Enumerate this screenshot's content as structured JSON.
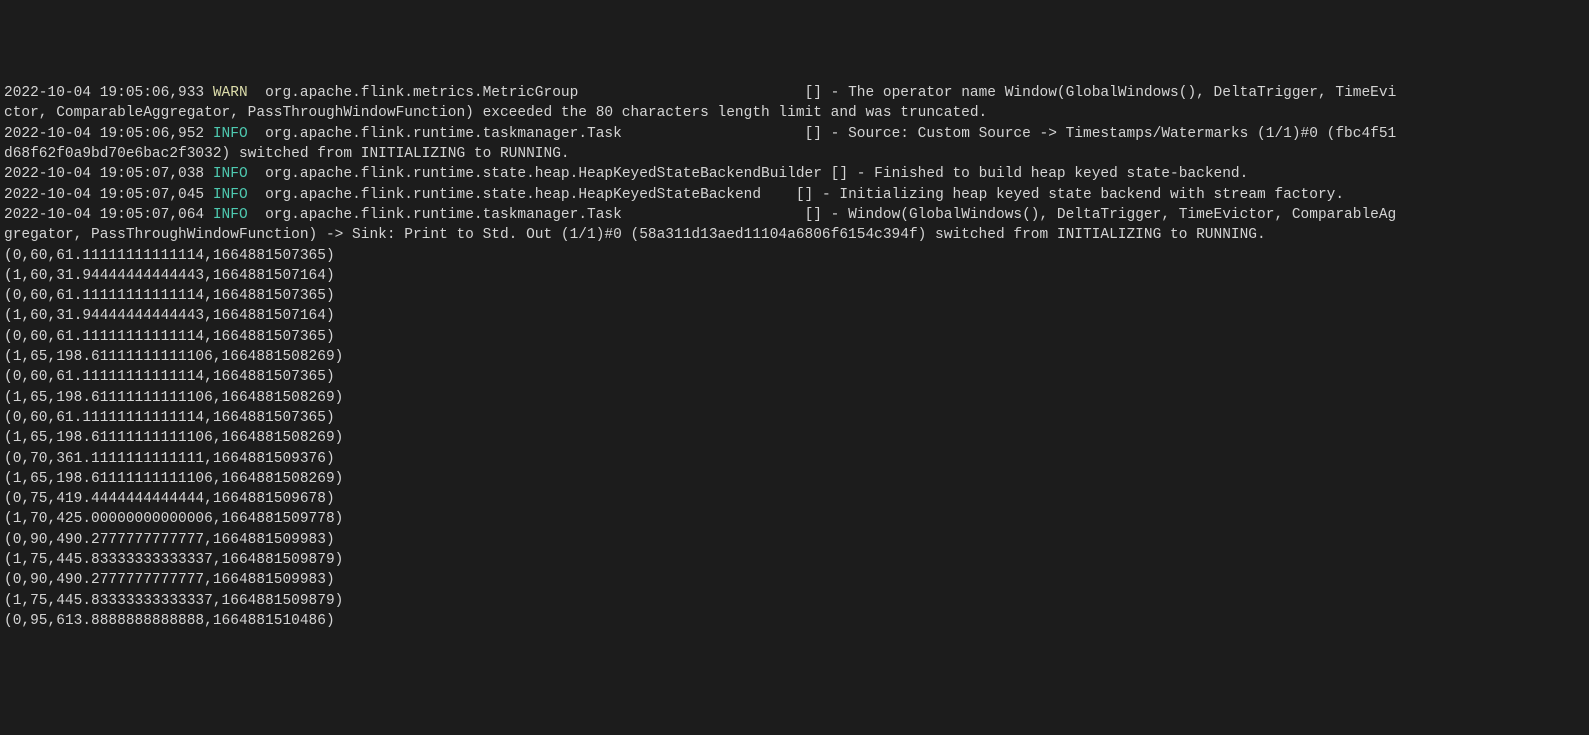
{
  "logs": [
    {
      "timestamp": "2022-10-04 19:05:06,933",
      "level": "WARN",
      "logger": "org.apache.flink.metrics.MetricGroup",
      "padding": "                          ",
      "message": "[] - The operator name Window(GlobalWindows(), DeltaTrigger, TimeEvi",
      "continuation": "ctor, ComparableAggregator, PassThroughWindowFunction) exceeded the 80 characters length limit and was truncated."
    },
    {
      "timestamp": "2022-10-04 19:05:06,952",
      "level": "INFO",
      "logger": "org.apache.flink.runtime.taskmanager.Task",
      "padding": "                     ",
      "message": "[] - Source: Custom Source -> Timestamps/Watermarks (1/1)#0 (fbc4f51",
      "continuation": "d68f62f0a9bd70e6bac2f3032) switched from INITIALIZING to RUNNING."
    },
    {
      "timestamp": "2022-10-04 19:05:07,038",
      "level": "INFO",
      "logger": "org.apache.flink.runtime.state.heap.HeapKeyedStateBackendBuilder",
      "padding": " ",
      "message": "[] - Finished to build heap keyed state-backend.",
      "continuation": null
    },
    {
      "timestamp": "2022-10-04 19:05:07,045",
      "level": "INFO",
      "logger": "org.apache.flink.runtime.state.heap.HeapKeyedStateBackend",
      "padding": "    ",
      "message": "[] - Initializing heap keyed state backend with stream factory.",
      "continuation": null
    },
    {
      "timestamp": "2022-10-04 19:05:07,064",
      "level": "INFO",
      "logger": "org.apache.flink.runtime.taskmanager.Task",
      "padding": "                     ",
      "message": "[] - Window(GlobalWindows(), DeltaTrigger, TimeEvictor, ComparableAg",
      "continuation": "gregator, PassThroughWindowFunction) -> Sink: Print to Std. Out (1/1)#0 (58a311d13aed11104a6806f6154c394f) switched from INITIALIZING to RUNNING."
    }
  ],
  "output": [
    "(0,60,61.11111111111114,1664881507365)",
    "(1,60,31.94444444444443,1664881507164)",
    "(0,60,61.11111111111114,1664881507365)",
    "(1,60,31.94444444444443,1664881507164)",
    "(0,60,61.11111111111114,1664881507365)",
    "(1,65,198.61111111111106,1664881508269)",
    "(0,60,61.11111111111114,1664881507365)",
    "(1,65,198.61111111111106,1664881508269)",
    "(0,60,61.11111111111114,1664881507365)",
    "(1,65,198.61111111111106,1664881508269)",
    "(0,70,361.1111111111111,1664881509376)",
    "(1,65,198.61111111111106,1664881508269)",
    "(0,75,419.4444444444444,1664881509678)",
    "(1,70,425.00000000000006,1664881509778)",
    "(0,90,490.2777777777777,1664881509983)",
    "(1,75,445.83333333333337,1664881509879)",
    "(0,90,490.2777777777777,1664881509983)",
    "(1,75,445.83333333333337,1664881509879)",
    "(0,95,613.8888888888888,1664881510486)"
  ]
}
